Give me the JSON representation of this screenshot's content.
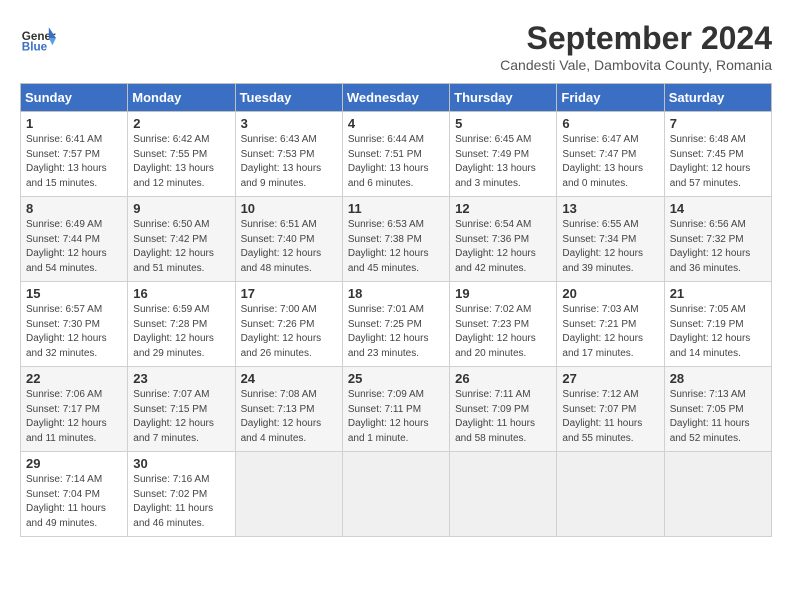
{
  "header": {
    "logo_line1": "General",
    "logo_line2": "Blue",
    "month": "September 2024",
    "location": "Candesti Vale, Dambovita County, Romania"
  },
  "days_of_week": [
    "Sunday",
    "Monday",
    "Tuesday",
    "Wednesday",
    "Thursday",
    "Friday",
    "Saturday"
  ],
  "weeks": [
    [
      {
        "day": "1",
        "info": "Sunrise: 6:41 AM\nSunset: 7:57 PM\nDaylight: 13 hours\nand 15 minutes."
      },
      {
        "day": "2",
        "info": "Sunrise: 6:42 AM\nSunset: 7:55 PM\nDaylight: 13 hours\nand 12 minutes."
      },
      {
        "day": "3",
        "info": "Sunrise: 6:43 AM\nSunset: 7:53 PM\nDaylight: 13 hours\nand 9 minutes."
      },
      {
        "day": "4",
        "info": "Sunrise: 6:44 AM\nSunset: 7:51 PM\nDaylight: 13 hours\nand 6 minutes."
      },
      {
        "day": "5",
        "info": "Sunrise: 6:45 AM\nSunset: 7:49 PM\nDaylight: 13 hours\nand 3 minutes."
      },
      {
        "day": "6",
        "info": "Sunrise: 6:47 AM\nSunset: 7:47 PM\nDaylight: 13 hours\nand 0 minutes."
      },
      {
        "day": "7",
        "info": "Sunrise: 6:48 AM\nSunset: 7:45 PM\nDaylight: 12 hours\nand 57 minutes."
      }
    ],
    [
      {
        "day": "8",
        "info": "Sunrise: 6:49 AM\nSunset: 7:44 PM\nDaylight: 12 hours\nand 54 minutes."
      },
      {
        "day": "9",
        "info": "Sunrise: 6:50 AM\nSunset: 7:42 PM\nDaylight: 12 hours\nand 51 minutes."
      },
      {
        "day": "10",
        "info": "Sunrise: 6:51 AM\nSunset: 7:40 PM\nDaylight: 12 hours\nand 48 minutes."
      },
      {
        "day": "11",
        "info": "Sunrise: 6:53 AM\nSunset: 7:38 PM\nDaylight: 12 hours\nand 45 minutes."
      },
      {
        "day": "12",
        "info": "Sunrise: 6:54 AM\nSunset: 7:36 PM\nDaylight: 12 hours\nand 42 minutes."
      },
      {
        "day": "13",
        "info": "Sunrise: 6:55 AM\nSunset: 7:34 PM\nDaylight: 12 hours\nand 39 minutes."
      },
      {
        "day": "14",
        "info": "Sunrise: 6:56 AM\nSunset: 7:32 PM\nDaylight: 12 hours\nand 36 minutes."
      }
    ],
    [
      {
        "day": "15",
        "info": "Sunrise: 6:57 AM\nSunset: 7:30 PM\nDaylight: 12 hours\nand 32 minutes."
      },
      {
        "day": "16",
        "info": "Sunrise: 6:59 AM\nSunset: 7:28 PM\nDaylight: 12 hours\nand 29 minutes."
      },
      {
        "day": "17",
        "info": "Sunrise: 7:00 AM\nSunset: 7:26 PM\nDaylight: 12 hours\nand 26 minutes."
      },
      {
        "day": "18",
        "info": "Sunrise: 7:01 AM\nSunset: 7:25 PM\nDaylight: 12 hours\nand 23 minutes."
      },
      {
        "day": "19",
        "info": "Sunrise: 7:02 AM\nSunset: 7:23 PM\nDaylight: 12 hours\nand 20 minutes."
      },
      {
        "day": "20",
        "info": "Sunrise: 7:03 AM\nSunset: 7:21 PM\nDaylight: 12 hours\nand 17 minutes."
      },
      {
        "day": "21",
        "info": "Sunrise: 7:05 AM\nSunset: 7:19 PM\nDaylight: 12 hours\nand 14 minutes."
      }
    ],
    [
      {
        "day": "22",
        "info": "Sunrise: 7:06 AM\nSunset: 7:17 PM\nDaylight: 12 hours\nand 11 minutes."
      },
      {
        "day": "23",
        "info": "Sunrise: 7:07 AM\nSunset: 7:15 PM\nDaylight: 12 hours\nand 7 minutes."
      },
      {
        "day": "24",
        "info": "Sunrise: 7:08 AM\nSunset: 7:13 PM\nDaylight: 12 hours\nand 4 minutes."
      },
      {
        "day": "25",
        "info": "Sunrise: 7:09 AM\nSunset: 7:11 PM\nDaylight: 12 hours\nand 1 minute."
      },
      {
        "day": "26",
        "info": "Sunrise: 7:11 AM\nSunset: 7:09 PM\nDaylight: 11 hours\nand 58 minutes."
      },
      {
        "day": "27",
        "info": "Sunrise: 7:12 AM\nSunset: 7:07 PM\nDaylight: 11 hours\nand 55 minutes."
      },
      {
        "day": "28",
        "info": "Sunrise: 7:13 AM\nSunset: 7:05 PM\nDaylight: 11 hours\nand 52 minutes."
      }
    ],
    [
      {
        "day": "29",
        "info": "Sunrise: 7:14 AM\nSunset: 7:04 PM\nDaylight: 11 hours\nand 49 minutes."
      },
      {
        "day": "30",
        "info": "Sunrise: 7:16 AM\nSunset: 7:02 PM\nDaylight: 11 hours\nand 46 minutes."
      },
      {
        "day": "",
        "info": ""
      },
      {
        "day": "",
        "info": ""
      },
      {
        "day": "",
        "info": ""
      },
      {
        "day": "",
        "info": ""
      },
      {
        "day": "",
        "info": ""
      }
    ]
  ]
}
